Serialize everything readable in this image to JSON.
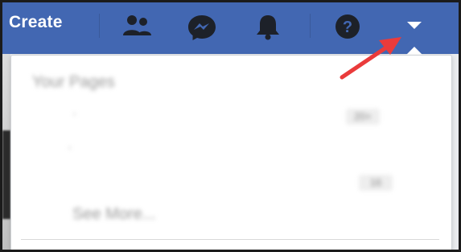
{
  "topbar": {
    "create_label": "Create",
    "icons": [
      "friends-icon",
      "messenger-icon",
      "notifications-icon",
      "help-icon",
      "dropdown-caret-icon"
    ]
  },
  "dropdown": {
    "section_title": "Your Pages",
    "rows": [
      {
        "bullet": "·",
        "badge": "20+"
      },
      {
        "bullet": "·",
        "badge": ""
      },
      {
        "bullet": "",
        "badge": "16"
      }
    ],
    "see_more_label": "See More..."
  },
  "colors": {
    "topbar": "#4267b2",
    "arrow": "#ea3b3b"
  }
}
